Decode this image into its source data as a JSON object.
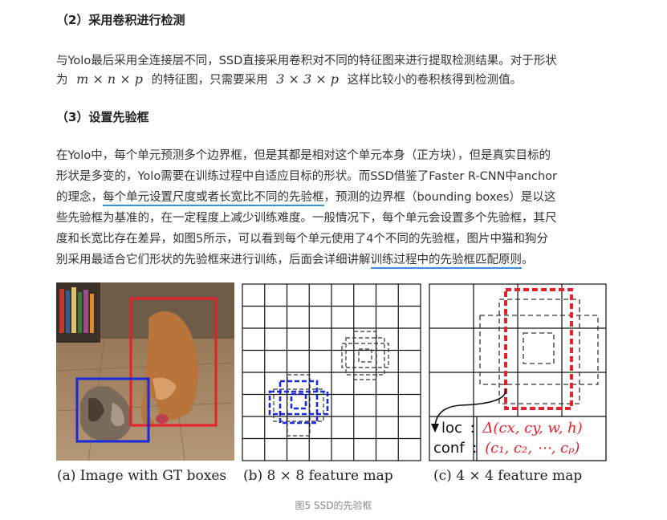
{
  "section2": {
    "heading": "（2）采用卷积进行检测",
    "line1": "与Yolo最后采用全连接层不同，SSD直接采用卷积对不同的特征图来进行提取检测结果。对于形状",
    "line2_pre": "为",
    "line2_math1": "m × n × p",
    "line2_mid": "的特征图，只需要采用",
    "line2_math2": "3 × 3 × p",
    "line2_post": "这样比较小的卷积核得到检测值。"
  },
  "section3": {
    "heading": "（3）设置先验框",
    "l1": "在Yolo中，每个单元预测多个边界框，但是其都是相对这个单元本身（正方块），但是真实目标的",
    "l2": "形状是多变的，Yolo需要在训练过程中自适应目标的形状。而SSD借鉴了Faster R-CNN中anchor",
    "l3_pre": "的理念，",
    "l3_ul": "每个单元设置尺度或者长宽比不同的先验框",
    "l3_post": "，预测的边界框（bounding boxes）是以这",
    "l4": "些先验框为基准的，在一定程度上减少训练难度。一般情况下，每个单元会设置多个先验框，其尺",
    "l5": "度和长宽比存在差异，如图5所示，可以看到每个单元使用了4个不同的先验框，图片中猫和狗分",
    "l6_pre": "别采用最适合它们形状的先验框来进行训练，后面会详细讲解",
    "l6_ul": "训练过程中的先验框匹配原则",
    "l6_post": "。"
  },
  "figure": {
    "cap_a": "(a) Image with GT boxes",
    "cap_b": "(b) 8 × 8 feature map",
    "cap_c": "(c) 4 × 4 feature map",
    "loc_label": "loc",
    "loc_value": "Δ(cx, cy, w, h)",
    "conf_label": "conf",
    "conf_value": "(c₁, c₂, ⋯, cₚ)",
    "colon": ":",
    "caption": "图5 SSD的先验框"
  }
}
